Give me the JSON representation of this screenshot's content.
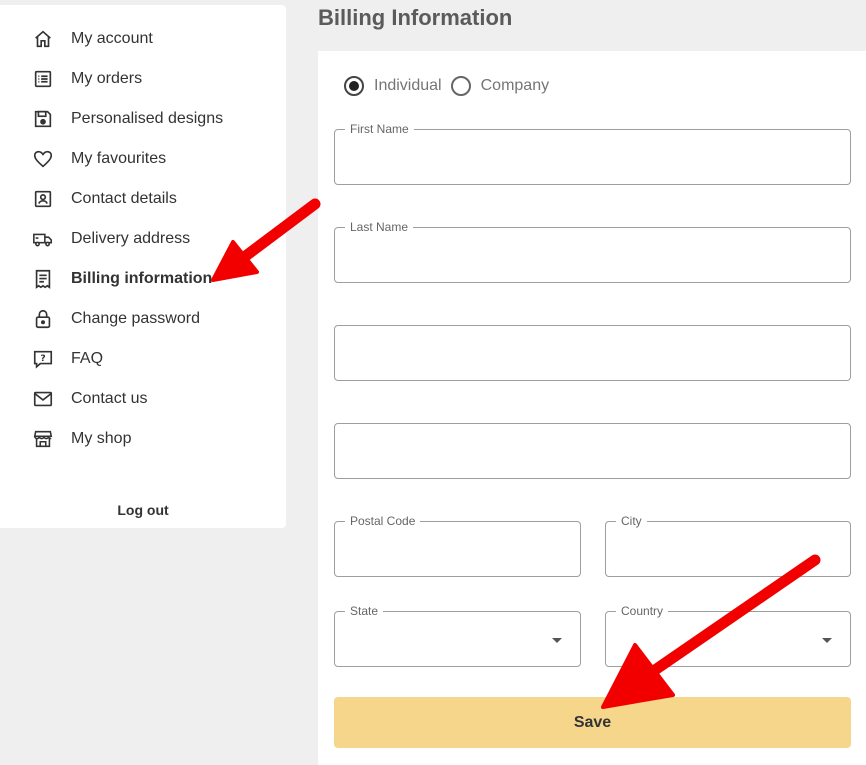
{
  "sidebar": {
    "items": [
      {
        "label": "My account",
        "icon": "home-icon"
      },
      {
        "label": "My orders",
        "icon": "list-icon"
      },
      {
        "label": "Personalised designs",
        "icon": "floppy-disk-icon"
      },
      {
        "label": "My favourites",
        "icon": "heart-icon"
      },
      {
        "label": "Contact details",
        "icon": "contact-card-icon"
      },
      {
        "label": "Delivery address",
        "icon": "truck-icon"
      },
      {
        "label": "Billing information",
        "icon": "receipt-icon",
        "active": true
      },
      {
        "label": "Change password",
        "icon": "lock-icon"
      },
      {
        "label": "FAQ",
        "icon": "question-icon"
      },
      {
        "label": "Contact us",
        "icon": "mail-icon"
      },
      {
        "label": "My shop",
        "icon": "storefront-icon"
      }
    ],
    "logout_label": "Log out"
  },
  "main": {
    "title": "Billing Information",
    "type_options": [
      {
        "label": "Individual",
        "selected": true
      },
      {
        "label": "Company",
        "selected": false
      }
    ],
    "fields": {
      "first_name": {
        "label": "First Name",
        "value": ""
      },
      "last_name": {
        "label": "Last Name",
        "value": ""
      },
      "address_1": {
        "label": "",
        "value": ""
      },
      "address_2": {
        "label": "",
        "value": ""
      },
      "postal_code": {
        "label": "Postal Code",
        "value": ""
      },
      "city": {
        "label": "City",
        "value": ""
      },
      "state": {
        "label": "State",
        "value": ""
      },
      "country": {
        "label": "Country",
        "value": ""
      }
    },
    "save_label": "Save"
  },
  "colors": {
    "save_button_bg": "#f6d68a",
    "annotation_arrow": "#f20000",
    "page_bg": "#efefef"
  }
}
